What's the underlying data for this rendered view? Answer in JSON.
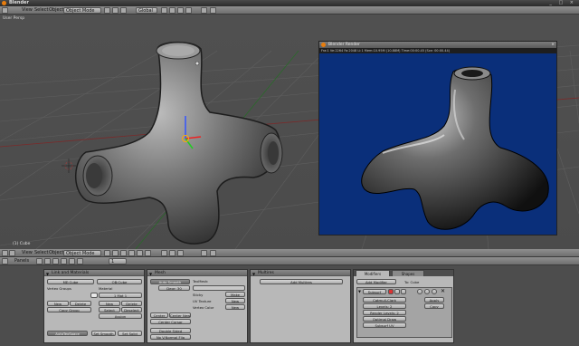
{
  "window": {
    "title": "Blender",
    "buttons": "_ □ ×"
  },
  "top_header": {
    "menus": [
      "View",
      "Select",
      "Object"
    ],
    "mode": "Object Mode",
    "shading": "Global"
  },
  "viewport": {
    "label_tl": "User Persp",
    "label_bl": "(1) Cube"
  },
  "render_window": {
    "title": "Blender Render",
    "stats": "Fra:1 Ve:2264 Fa:2048 Li:1 Mem:10.95M (10.88M) Time:00:00.45 (Sce: 00:00.44)"
  },
  "lower_header": {
    "menus": [
      "View",
      "Select",
      "Object"
    ],
    "mode": "Object Mode",
    "frame": "1"
  },
  "buttons_header": {
    "panels_label": "Panels",
    "frame": "1"
  },
  "panel_link": {
    "title": "Link and Materials",
    "me_field": "ME:Cube",
    "ob_field": "OB:Cube",
    "vertex_groups": "Vertex Groups",
    "material": "Material",
    "mat_field": "1 Mat 1",
    "btn_new": "New",
    "btn_delete": "Delete",
    "btn_new2": "New",
    "btn_delete2": "Delete",
    "btn_copy_group": "Copy Group",
    "btn_select": "Select",
    "btn_deselect": "Deselect",
    "btn_assign": "Assign",
    "btn_autotexspace": "AutoTexSpace",
    "btn_set_smooth": "Set Smooth",
    "btn_set_solid": "Set Solid"
  },
  "panel_mesh": {
    "title": "Mesh",
    "auto_smooth": "Auto Smooth",
    "degr": "Degr: 30",
    "texmesh": "TexMesh:",
    "sticky": "Sticky",
    "make": "Make",
    "uv_texture": "UV Texture",
    "new1": "New",
    "vertex_color": "Vertex Color",
    "new2": "New",
    "center": "Center",
    "center_new": "Center New",
    "center_cursor": "Center Cursor",
    "double_sided": "Double Sided",
    "no_vnormal_flip": "No V.Normal Flip"
  },
  "panel_multires": {
    "title": "Multires",
    "add_multires": "Add Multires"
  },
  "panel_modifiers": {
    "tab_modifiers": "Modifiers",
    "tab_shapes": "Shapes",
    "add_modifier": "Add Modifier",
    "to_label": "To: Cube",
    "modifier_name": "Subsurf",
    "subtype": "Catmull-Clark",
    "levels": "Levels: 2",
    "render_levels": "Render Levels: 2",
    "optimal_draw": "Optimal Draw",
    "subsurf_uv": "Subsurf UV",
    "apply": "Apply",
    "copy": "Copy"
  },
  "colors": {
    "render_bg": "#0a2f7a",
    "viewport_bg": "#4e4e4e",
    "panel_bg": "#b8b8b8",
    "blender_orange": "#e87d0d"
  }
}
